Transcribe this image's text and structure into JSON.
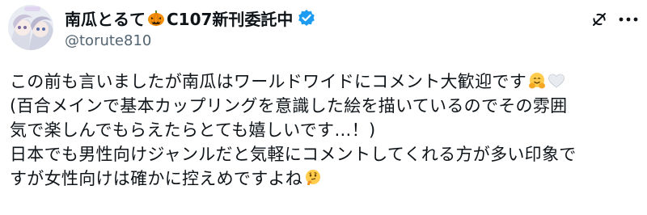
{
  "post": {
    "author": {
      "display_name": "南瓜とるて",
      "name_suffix": "C107新刊委託中",
      "handle": "@torute810",
      "verified": true,
      "name_icon": "jack-o-lantern-icon",
      "avatar": "avatar-image"
    },
    "actions": {
      "grok_icon": "grok-icon",
      "more_icon": "more-options-icon"
    },
    "text_lines": [
      "この前も言いましたが南瓜はワールドワイドにコメント大歓迎です",
      "(百合メインで基本カップリングを意識した絵を描いているのでその雰囲",
      "気で楽しんでもらえたらとても嬉しいです…！)",
      "日本でも男性向けジャンルだと気軽にコメントしてくれる方が多い印象で",
      "すが女性向けは確かに控えめですよね"
    ],
    "emojis": {
      "line1": [
        "hugging-face-icon",
        "white-heart-icon"
      ],
      "line5": [
        "thinking-face-icon"
      ]
    }
  },
  "colors": {
    "text": "#0f1419",
    "secondary_text": "#536471",
    "verified_blue": "#1d9bf0",
    "pumpkin_orange": "#f4900c"
  }
}
